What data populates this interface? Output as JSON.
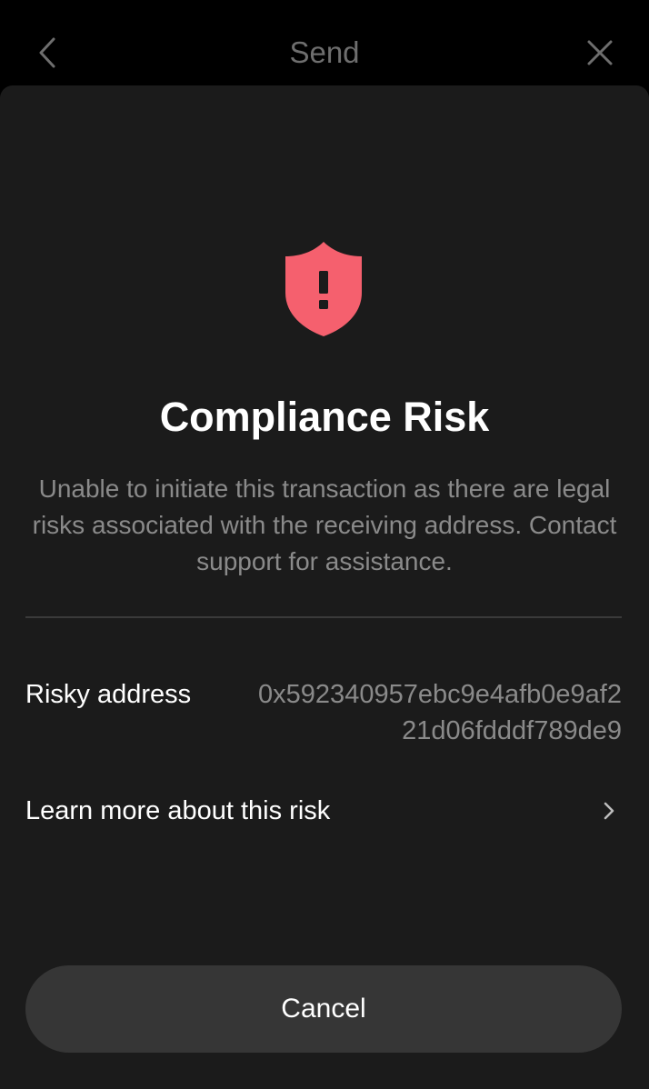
{
  "header": {
    "title": "Send",
    "back_icon": "chevron-left-icon",
    "close_icon": "close-icon"
  },
  "alert": {
    "icon": "shield-exclamation-icon",
    "icon_color": "#f5606e",
    "title": "Compliance Risk",
    "description": "Unable to initiate this transaction as there are legal risks associated with the receiving address. Contact support for assistance."
  },
  "details": {
    "risky_address_label": "Risky address",
    "risky_address_value": "0x592340957ebc9e4afb0e9af221d06fdddf789de9"
  },
  "learn_more": {
    "label": "Learn more about this risk",
    "icon": "chevron-right-icon"
  },
  "actions": {
    "cancel_label": "Cancel"
  }
}
